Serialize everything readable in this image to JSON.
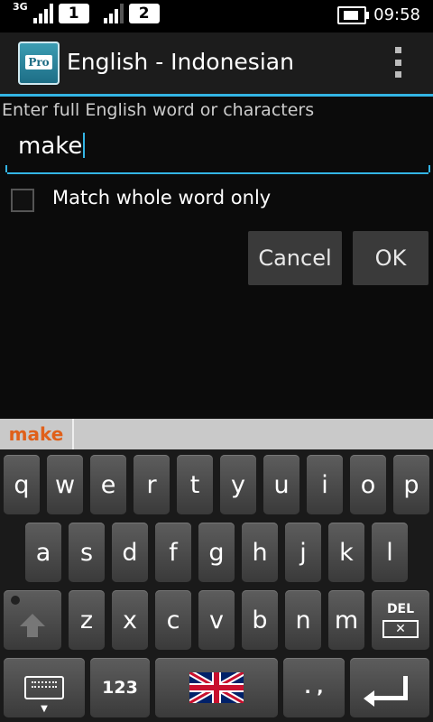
{
  "statusbar": {
    "network": "3G",
    "sim1": "1",
    "sim2": "2",
    "time": "09:58"
  },
  "actionbar": {
    "app_icon_text": "Pro",
    "title": "English - Indonesian"
  },
  "dialog": {
    "prompt": "Enter full English word or characters",
    "input_value": "make",
    "checkbox_label": "Match whole word only",
    "checkbox_checked": false,
    "cancel_label": "Cancel",
    "ok_label": "OK"
  },
  "suggestions": [
    "make"
  ],
  "keyboard": {
    "row1": [
      "q",
      "w",
      "e",
      "r",
      "t",
      "y",
      "u",
      "i",
      "o",
      "p"
    ],
    "row2": [
      "a",
      "s",
      "d",
      "f",
      "g",
      "h",
      "j",
      "k",
      "l"
    ],
    "row3": [
      "z",
      "x",
      "c",
      "v",
      "b",
      "n",
      "m"
    ],
    "del_label": "DEL",
    "num_label": "123",
    "punct_label": ". ,",
    "language_icon": "uk-flag-icon"
  },
  "colors": {
    "accent": "#33b5e5",
    "suggestion": "#e0601a"
  }
}
